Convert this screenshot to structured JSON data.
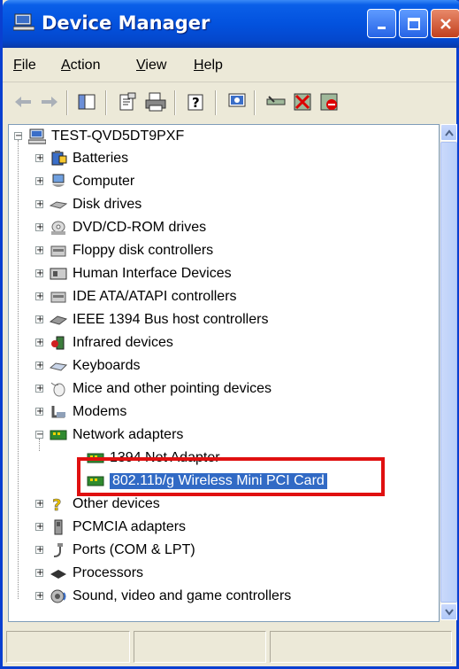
{
  "window": {
    "title": "Device Manager"
  },
  "menu": {
    "items": [
      {
        "underline": "F",
        "rest": "ile"
      },
      {
        "underline": "A",
        "rest": "ction"
      },
      {
        "underline": "V",
        "rest": "iew"
      },
      {
        "underline": "H",
        "rest": "elp"
      }
    ]
  },
  "toolbar": {
    "icons": [
      "back-icon",
      "forward-icon",
      "show-hide-tree-icon",
      "properties-icon",
      "print-icon",
      "help-icon",
      "scan-hardware-icon",
      "update-driver-icon",
      "uninstall-icon",
      "disable-icon"
    ]
  },
  "tree": {
    "root": "TEST-QVD5DT9PXF",
    "items": [
      {
        "label": "Batteries",
        "icon": "battery-icon"
      },
      {
        "label": "Computer",
        "icon": "computer-icon"
      },
      {
        "label": "Disk drives",
        "icon": "disk-drive-icon"
      },
      {
        "label": "DVD/CD-ROM drives",
        "icon": "dvd-icon"
      },
      {
        "label": "Floppy disk controllers",
        "icon": "floppy-icon"
      },
      {
        "label": "Human Interface Devices",
        "icon": "hid-icon"
      },
      {
        "label": "IDE ATA/ATAPI controllers",
        "icon": "ide-icon"
      },
      {
        "label": "IEEE 1394 Bus host controllers",
        "icon": "firewire-icon"
      },
      {
        "label": "Infrared devices",
        "icon": "infrared-icon"
      },
      {
        "label": "Keyboards",
        "icon": "keyboard-icon"
      },
      {
        "label": "Mice and other pointing devices",
        "icon": "mouse-icon"
      },
      {
        "label": "Modems",
        "icon": "modem-icon"
      },
      {
        "label": "Network adapters",
        "icon": "network-adapter-icon"
      }
    ],
    "network_children": [
      {
        "label": "1394 Net Adapter"
      },
      {
        "label": "802.11b/g Wireless Mini PCI Card",
        "selected": true
      }
    ],
    "items_after": [
      {
        "label": "Other devices",
        "icon": "unknown-device-icon"
      },
      {
        "label": "PCMCIA adapters",
        "icon": "pcmcia-icon"
      },
      {
        "label": "Ports (COM & LPT)",
        "icon": "port-icon"
      },
      {
        "label": "Processors",
        "icon": "processor-icon"
      },
      {
        "label": "Sound, video and game controllers",
        "icon": "sound-icon"
      }
    ]
  },
  "colors": {
    "titlebar": "#0352de",
    "selection": "#316ac5",
    "highlight_box": "#e01010"
  }
}
